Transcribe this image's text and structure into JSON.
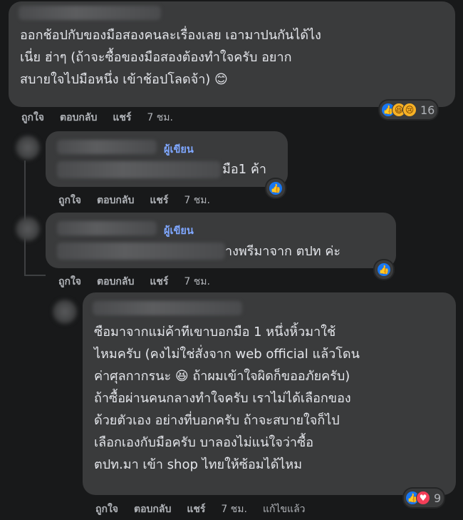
{
  "comments": [
    {
      "lines": [
        "ออกช้อปกับของมือสองคนละเรื่องเลย เอามาปนกันได้ไง",
        "เนี่ย ฮ่าๆ (ถ้าจะซื้อของมือสองต้องทำใจครับ อยาก",
        "สบายใจไปมือหนึ่ง เข้าช้อปโลดจ้า) 😊"
      ],
      "actions": {
        "like": "ถูกใจ",
        "reply": "ตอบกลับ",
        "share": "แชร์",
        "time": "7 ชม."
      },
      "reactions": {
        "icons": [
          "like-icon",
          "haha-icon",
          "sad-icon"
        ],
        "count": "16"
      }
    },
    {
      "author_badge": "ผู้เขียน",
      "lines": [
        "มือ1 ค้า"
      ],
      "actions": {
        "like": "ถูกใจ",
        "reply": "ตอบกลับ",
        "share": "แชร์",
        "time": "7 ชม."
      },
      "reactions": {
        "icons": [
          "like-icon"
        ]
      }
    },
    {
      "author_badge": "ผู้เขียน",
      "lines": [
        "างพรีมาจาก ตปท ค่ะ"
      ],
      "actions": {
        "like": "ถูกใจ",
        "reply": "ตอบกลับ",
        "share": "แชร์",
        "time": "7 ชม."
      },
      "reactions": {
        "icons": [
          "like-icon"
        ]
      }
    },
    {
      "lines": [
        "ซือมาจากแม่ค้าทีเขาบอกมือ 1 หนึ่งหิ้วมาใช้",
        "ไหมครับ (คงไม่ใช่สั่งจาก web official แล้วโดน",
        "ค่าศุลกากรนะ 😆 ถ้าผมเข้าใจผิดก็ขออภัยครับ)",
        "ถ้าซื้อผ่านคนกลางทำใจครับ เราไม่ได้เลือกของ",
        "ด้วยตัวเอง อย่างที่บอกครับ ถ้าจะสบายใจก็ไป",
        "เลือกเองกับมือครับ บาลองไม่แน่ใจว่าซื้อ",
        "ตปท.มา เข้า shop ไทยให้ซ้อมได้ไหม"
      ],
      "actions": {
        "like": "ถูกใจ",
        "reply": "ตอบกลับ",
        "share": "แชร์",
        "time": "7 ชม.",
        "edited": "แก้ไขแล้ว"
      },
      "reactions": {
        "icons": [
          "like-icon",
          "love-icon"
        ],
        "count": "9"
      }
    }
  ],
  "colors": {
    "background": "#18191a",
    "bubble": "#3a3b3c",
    "author_badge": "#7fa7ff",
    "like_blue": "#1877f2"
  }
}
